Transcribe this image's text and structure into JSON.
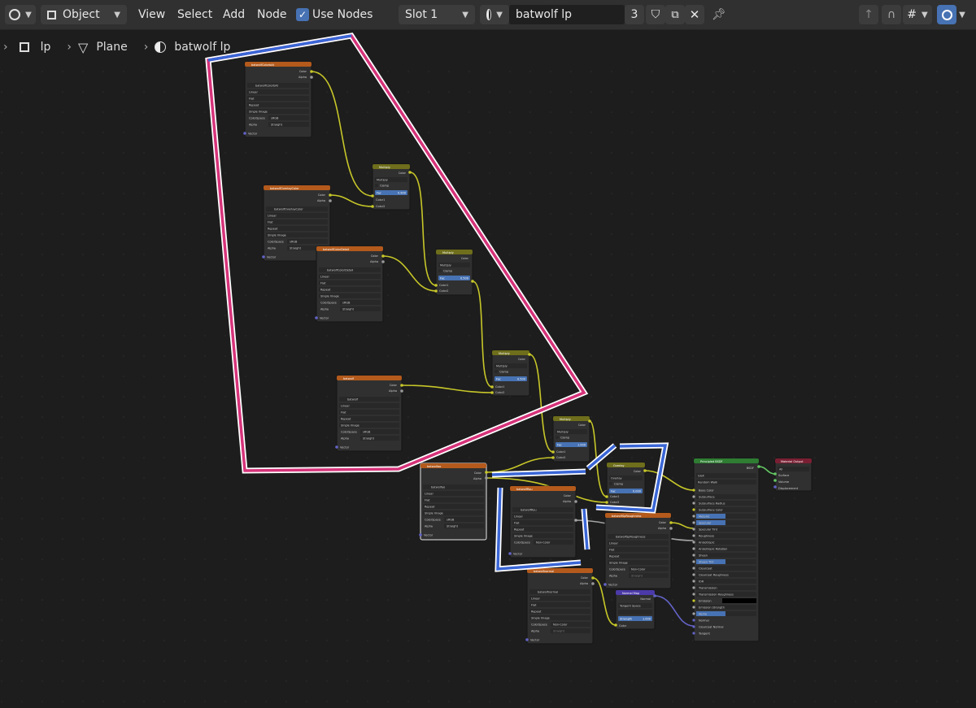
{
  "header": {
    "editor_type_icon": "node-editor-icon",
    "mode_dropdown": "Object",
    "menus": [
      "View",
      "Select",
      "Add",
      "Node"
    ],
    "use_nodes_label": "Use Nodes",
    "use_nodes_checked": true,
    "slot_dropdown": "Slot 1",
    "material_name": "batwolf lp",
    "user_count": "3",
    "accent_color": "#4772b3"
  },
  "breadcrumb": {
    "object": "lp",
    "mesh": "Plane",
    "material": "batwolf lp"
  },
  "annotations": {
    "pink_outline_color": "#d6337a",
    "blue_outline_color": "#3a66d6"
  },
  "nodes": {
    "img1": {
      "title": "batwolfColorbAt",
      "file": "batwolfColorbAt"
    },
    "img2": {
      "title": "batwolfOverlayColor",
      "file": "batwolfOverlayColor"
    },
    "img3": {
      "title": "batwolfColorDetail",
      "file": "batwolfColorDetail"
    },
    "img4": {
      "title": "batwolf",
      "file": "batwolf"
    },
    "img5": {
      "title": "batwolfao",
      "file": "batwolfao"
    },
    "img6": {
      "title": "batwolfRou",
      "file": "batwolfRou"
    },
    "img7": {
      "title": "batwolfSpRoughness",
      "file": "batwolfSpRoughness"
    },
    "img8": {
      "title": "batwolfnormal",
      "file": "batwolfnormal"
    },
    "mix1": {
      "title": "Multiply",
      "fac": "0.900"
    },
    "mix2": {
      "title": "Multiply",
      "fac": "0.500"
    },
    "mix3": {
      "title": "Multiply",
      "fac": "0.500"
    },
    "mix4": {
      "title": "Multiply",
      "fac": "1.000"
    },
    "mix5": {
      "title": "Overlay",
      "fac": "0.000"
    },
    "bsdf": {
      "title": "Principled BSDF"
    },
    "output": {
      "title": "Material Output"
    },
    "normalmap": {
      "title": "Normal Map"
    },
    "img_rows": [
      "Linear",
      "Flat",
      "Repeat",
      "Single Image"
    ],
    "color_space_label": "ColorSpace",
    "color_space_srgb": "sRGB",
    "color_space_noncolor": "Non-Color",
    "alpha_label": "Alpha",
    "alpha_value": "Straight",
    "vector_label": "Vector",
    "out_color": "Color",
    "out_alpha": "Alpha",
    "fac_label": "Fac",
    "clamp_label": "Clamp",
    "color1_label": "Color1",
    "color2_label": "Color2",
    "bsdf_out": "BSDF",
    "bsdf_method": "GGX",
    "bsdf_sss": "Random Walk",
    "bsdf_inputs": [
      "Base Color",
      "Subsurface",
      "Subsurface Radius",
      "Subsurface Color",
      "Metallic",
      "Specular",
      "Specular Tint",
      "Roughness",
      "Anisotropic",
      "Anisotropic Rotation",
      "Sheen",
      "Sheen Tint",
      "Clearcoat",
      "Clearcoat Roughness",
      "IOR",
      "Transmission",
      "Transmission Roughness",
      "Emission",
      "Emission Strength",
      "Alpha",
      "Normal",
      "Clearcoat Normal",
      "Tangent"
    ],
    "output_target": "All",
    "output_sockets": [
      "Surface",
      "Volume",
      "Displacement"
    ],
    "normal_space": "Tangent Space",
    "normal_strength_label": "Strength",
    "normal_strength": "1.000",
    "normal_out": "Normal"
  }
}
